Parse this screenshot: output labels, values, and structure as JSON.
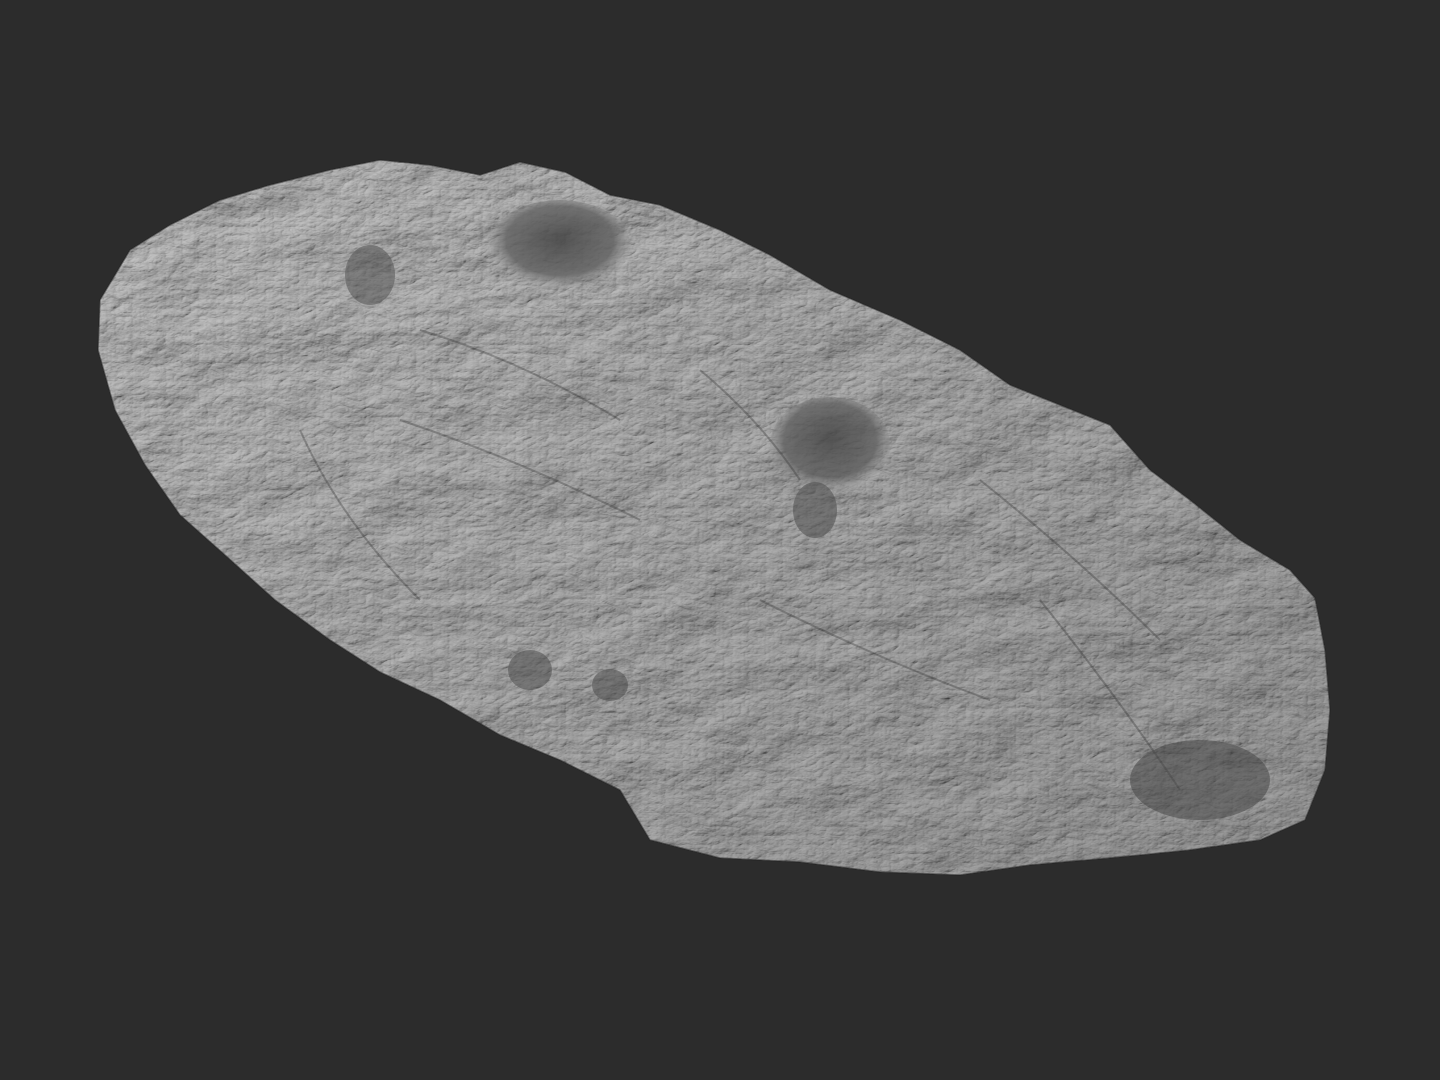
{
  "scene": {
    "background_color": "#2c2c2c",
    "subject": "terrain-sculpt-model",
    "material_base_color": "#8e8e8e",
    "material_highlight_color": "#d2d2d2",
    "material_shadow_color": "#3a3a3a",
    "render_style": "grayscale-clay"
  }
}
